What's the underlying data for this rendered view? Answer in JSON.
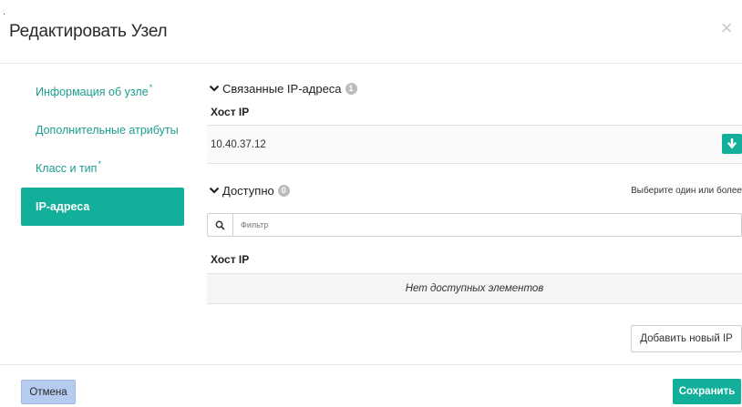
{
  "dialog": {
    "title": "Редактировать Узел",
    "close_glyph": "×"
  },
  "sidebar": {
    "items": [
      {
        "label": "Информация об узле",
        "required": "*"
      },
      {
        "label": "Дополнительные атрибуты",
        "required": ""
      },
      {
        "label": "Класс и тип",
        "required": "*"
      },
      {
        "label": "IP-адреса",
        "required": "",
        "active": true
      }
    ]
  },
  "associated": {
    "heading": "Связанные IP-адреса",
    "count": "1",
    "column_header": "Хост IP",
    "rows": [
      "10.40.37.12"
    ]
  },
  "available": {
    "heading": "Доступно",
    "count": "0",
    "hint": "Выберите один или более",
    "filter_placeholder": "Фильтр",
    "column_header": "Хост IP",
    "empty_message": "Нет доступных элементов"
  },
  "buttons": {
    "add_ip": "Добавить новый IP",
    "cancel": "Отмена",
    "save": "Сохранить"
  },
  "colors": {
    "accent": "#12b09a",
    "cancel_bg": "#b5cbf0"
  },
  "icons": [
    "chevron-down-icon",
    "search-icon",
    "arrow-down-icon",
    "close-icon"
  ]
}
